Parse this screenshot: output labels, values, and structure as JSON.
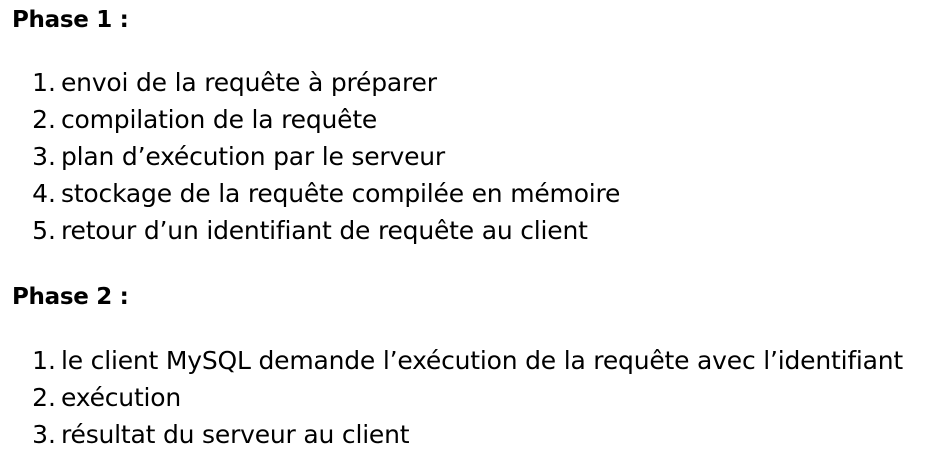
{
  "phases": [
    {
      "heading": "Phase 1 :",
      "steps": [
        {
          "num": "1.",
          "text": "envoi de la requête à préparer"
        },
        {
          "num": "2.",
          "text": "compilation de la requête"
        },
        {
          "num": "3.",
          "text": "plan d’exécution par le serveur"
        },
        {
          "num": "4.",
          "text": "stockage de la requête compilée en mémoire"
        },
        {
          "num": "5.",
          "text": "retour d’un identifiant de requête au client"
        }
      ]
    },
    {
      "heading": "Phase 2 :",
      "steps": [
        {
          "num": "1.",
          "text": "le client MySQL demande l’exécution de la requête avec l’identifiant"
        },
        {
          "num": "2.",
          "text": "exécution"
        },
        {
          "num": "3.",
          "text": "résultat du serveur au client"
        }
      ]
    }
  ]
}
